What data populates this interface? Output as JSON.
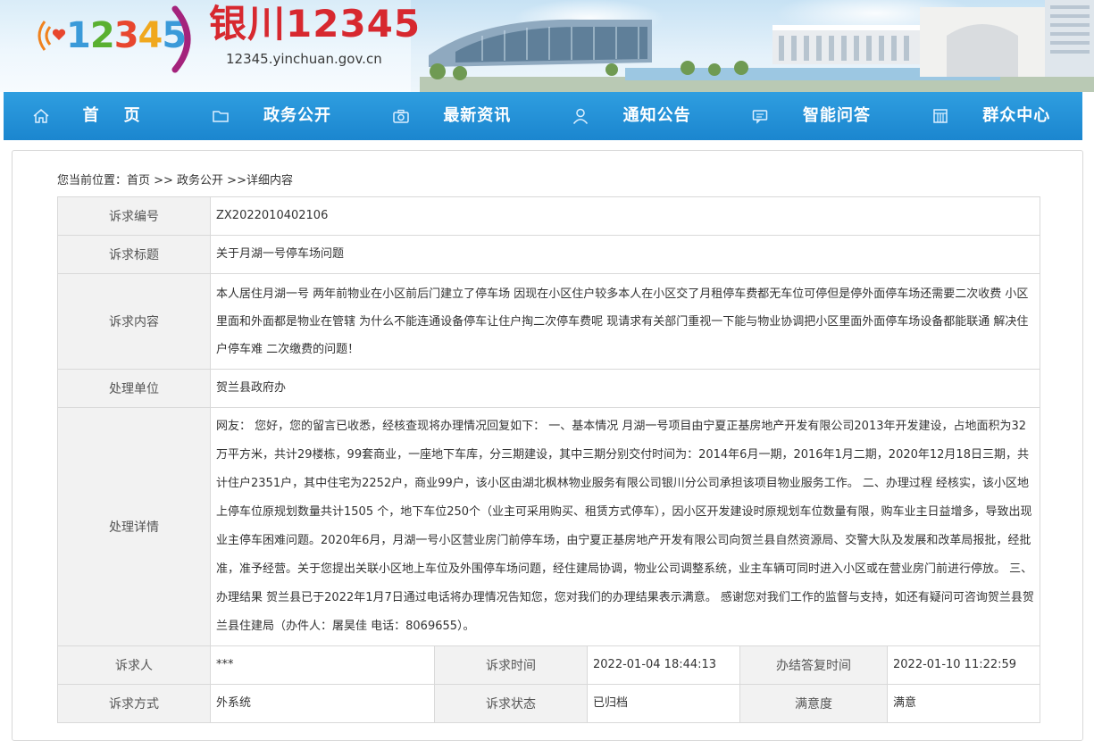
{
  "header": {
    "logo_number": "12345",
    "site_title": "银川12345",
    "site_url": "12345.yinchuan.gov.cn"
  },
  "nav": [
    {
      "label": "首页",
      "icon": "home-icon"
    },
    {
      "label": "政务公开",
      "icon": "folder-icon"
    },
    {
      "label": "最新资讯",
      "icon": "camera-icon"
    },
    {
      "label": "通知公告",
      "icon": "user-icon"
    },
    {
      "label": "智能问答",
      "icon": "chat-icon"
    },
    {
      "label": "群众中心",
      "icon": "building-icon"
    }
  ],
  "breadcrumb": "您当前位置：首页 >> 政务公开 >>详细内容",
  "detail": {
    "id_label": "诉求编号",
    "id_value": "ZX2022010402106",
    "title_label": "诉求标题",
    "title_value": "关于月湖一号停车场问题",
    "content_label": "诉求内容",
    "content_value": "本人居住月湖一号 两年前物业在小区前后门建立了停车场 因现在小区住户较多本人在小区交了月租停车费都无车位可停但是停外面停车场还需要二次收费 小区里面和外面都是物业在管辖 为什么不能连通设备停车让住户掏二次停车费呢 现请求有关部门重视一下能与物业协调把小区里面外面停车场设备都能联通 解决住户停车难 二次缴费的问题！",
    "unit_label": "处理单位",
    "unit_value": "贺兰县政府办",
    "process_label": "处理详情",
    "process_value": "网友：  您好，您的留言已收悉，经核查现将办理情况回复如下： 一、基本情况 月湖一号项目由宁夏正基房地产开发有限公司2013年开发建设，占地面积为32万平方米，共计29楼栋，99套商业，一座地下车库，分三期建设，其中三期分别交付时间为：2014年6月一期，2016年1月二期，2020年12月18日三期，共计住户2351户，其中住宅为2252户，商业99户，该小区由湖北枫林物业服务有限公司银川分公司承担该项目物业服务工作。 二、办理过程 经核实，该小区地上停车位原规划数量共计1505 个，地下车位250个（业主可采用购买、租赁方式停车），因小区开发建设时原规划车位数量有限，购车业主日益增多，导致出现业主停车困难问题。2020年6月，月湖一号小区营业房门前停车场，由宁夏正基房地产开发有限公司向贺兰县自然资源局、交警大队及发展和改革局报批，经批准，准予经营。关于您提出关联小区地上车位及外围停车场问题，经住建局协调，物业公司调整系统，业主车辆可同时进入小区或在营业房门前进行停放。 三、办理结果 贺兰县已于2022年1月7日通过电话将办理情况告知您，您对我们的办理结果表示满意。 感谢您对我们工作的监督与支持，如还有疑问可咨询贺兰县贺兰县住建局（办件人：屠昊佳 电话：8069655）。",
    "requester_label": "诉求人",
    "requester_value": "***",
    "time_label": "诉求时间",
    "time_value": "2022-01-04 18:44:13",
    "reply_time_label": "办结答复时间",
    "reply_time_value": "2022-01-10 11:22:59",
    "method_label": "诉求方式",
    "method_value": "外系统",
    "status_label": "诉求状态",
    "status_value": "已归档",
    "satisfaction_label": "满意度",
    "satisfaction_value": "满意"
  },
  "colors": {
    "nav_bg": "#1b86cf",
    "title_red": "#d7282f",
    "label_bg": "#f2f2f2",
    "border": "#d9d9d9"
  }
}
